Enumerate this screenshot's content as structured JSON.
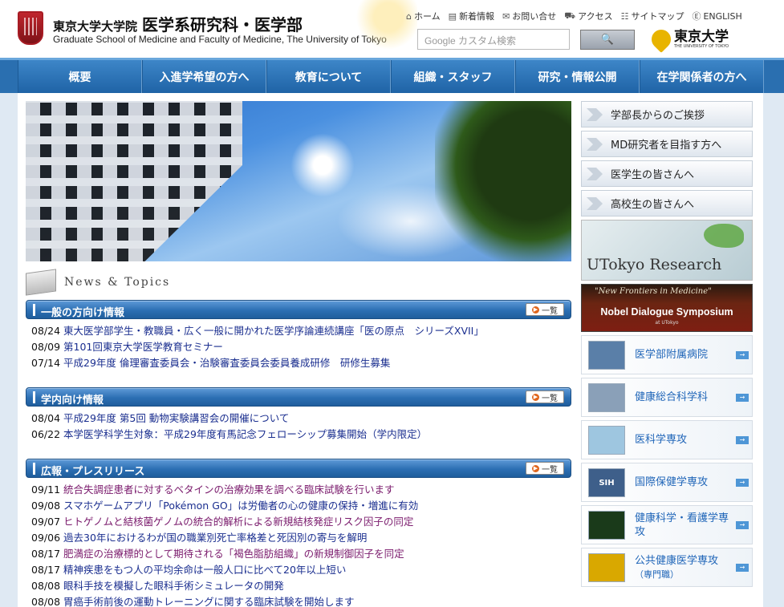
{
  "header": {
    "univ_label": "東京大学大学院",
    "faculty_label": "医学系研究科・医学部",
    "english_name": "Graduate School of Medicine and Faculty of Medicine, The University of Tokyo",
    "utility_nav": [
      {
        "icon": "home-icon",
        "glyph": "⌂",
        "label": "ホーム"
      },
      {
        "icon": "news-document-icon",
        "glyph": "▤",
        "label": "新着情報"
      },
      {
        "icon": "envelope-icon",
        "glyph": "✉",
        "label": "お問い合せ"
      },
      {
        "icon": "car-icon",
        "glyph": "⛟",
        "label": "アクセス"
      },
      {
        "icon": "sitemap-icon",
        "glyph": "☷",
        "label": "サイトマップ"
      },
      {
        "icon": "english-icon",
        "glyph": "Ⓔ",
        "label": "ENGLISH"
      }
    ],
    "search_placeholder": "Google カスタム検索",
    "search_button_icon": "search-icon",
    "utokyo_logo_text": "東京大学",
    "utokyo_logo_sub": "THE UNIVERSITY OF TOKYO"
  },
  "global_nav": [
    "概要",
    "入進学希望の方へ",
    "教育について",
    "組織・スタッフ",
    "研究・情報公開",
    "在学関係者の方へ"
  ],
  "news": {
    "heading": "News & Topics",
    "list_button_label": "一覧",
    "sections": [
      {
        "title": "一般の方向け情報",
        "items": [
          {
            "date": "08/24",
            "title": "東大医学部学生・教職員・広く一般に開かれた医学序論連続講座「医の原点　シリーズXVII」",
            "style": "blue"
          },
          {
            "date": "08/09",
            "title": "第101回東京大学医学教育セミナー",
            "style": "blue"
          },
          {
            "date": "07/14",
            "title": "平成29年度 倫理審査委員会・治験審査委員会委員養成研修　研修生募集",
            "style": "blue"
          }
        ]
      },
      {
        "title": "学内向け情報",
        "items": [
          {
            "date": "08/04",
            "title": "平成29年度 第5回 動物実験講習会の開催について",
            "style": "blue"
          },
          {
            "date": "06/22",
            "title": "本学医学科学生対象：平成29年度有馬記念フェローシップ募集開始（学内限定）",
            "style": "blue"
          }
        ]
      },
      {
        "title": "広報・プレスリリース",
        "items": [
          {
            "date": "09/11",
            "title": "統合失調症患者に対するベタインの治療効果を調べる臨床試験を行います",
            "style": "purple"
          },
          {
            "date": "09/08",
            "title": "スマホゲームアプリ「Pokémon GO」は労働者の心の健康の保持・増進に有効",
            "style": "blue"
          },
          {
            "date": "09/07",
            "title": "ヒトゲノムと結核菌ゲノムの統合的解析による新規結核発症リスク因子の同定",
            "style": "purple"
          },
          {
            "date": "09/06",
            "title": "過去30年におけるわが国の職業別死亡率格差と死因別の寄与を解明",
            "style": "blue"
          },
          {
            "date": "08/17",
            "title": "肥満症の治療標的として期待される「褐色脂肪組織」の新規制御因子を同定",
            "style": "purple"
          },
          {
            "date": "08/17",
            "title": "精神疾患をもつ人の平均余命は一般人口に比べて20年以上短い",
            "style": "blue"
          },
          {
            "date": "08/08",
            "title": "眼科手技を模擬した眼科手術シミュレータの開発",
            "style": "blue"
          },
          {
            "date": "08/08",
            "title": "胃癌手術前後の運動トレーニングに関する臨床試験を開始します",
            "style": "blue"
          }
        ]
      }
    ]
  },
  "sidebar": {
    "buttons": [
      "学部長からのご挨拶",
      "MD研究者を目指す方へ",
      "医学生の皆さんへ",
      "高校生の皆さんへ"
    ],
    "research_banner": "UTokyo Research",
    "nobel_banner": {
      "top": "\"New Frontiers in Medicine\"",
      "title": "Nobel Dialogue Symposium",
      "sub": "at UTokyo"
    },
    "departments": [
      {
        "label": "医学部附属病院",
        "sub": "",
        "thumb": "#5a7fa8"
      },
      {
        "label": "健康総合科学科",
        "sub": "",
        "thumb": "#8aa0b8"
      },
      {
        "label": "医科学専攻",
        "sub": "",
        "thumb": "#9ec6e0"
      },
      {
        "label": "国際保健学専攻",
        "sub": "",
        "thumb": "#3e5f8a",
        "thumb_text": "SIH"
      },
      {
        "label": "健康科学・看護学専攻",
        "sub": "",
        "thumb": "#1a3a1a"
      },
      {
        "label": "公共健康医学専攻",
        "sub": "（専門職）",
        "thumb": "#d9a800"
      }
    ]
  }
}
